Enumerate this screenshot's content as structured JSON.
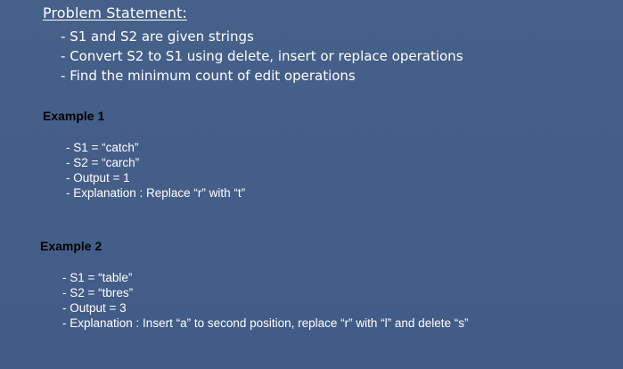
{
  "problem": {
    "title": "Problem Statement:",
    "bullets": [
      "S1 and S2 are given strings",
      "Convert S2 to S1 using delete, insert or replace operations",
      "Find the minimum count of edit operations"
    ]
  },
  "example1": {
    "title": "Example 1",
    "lines": [
      "S1 = “catch”",
      "S2 = “carch”",
      "Output = 1",
      "Explanation : Replace “r” with “t”"
    ]
  },
  "example2": {
    "title": "Example 2",
    "lines": [
      "S1 = “table”",
      "S2 = “tbres”",
      "Output = 3",
      "Explanation : Insert “a” to second position, replace “r” with “l” and delete “s”"
    ]
  },
  "colors": {
    "background": "#435d8a",
    "text": "#ffffff",
    "example_heading": "#000000"
  }
}
